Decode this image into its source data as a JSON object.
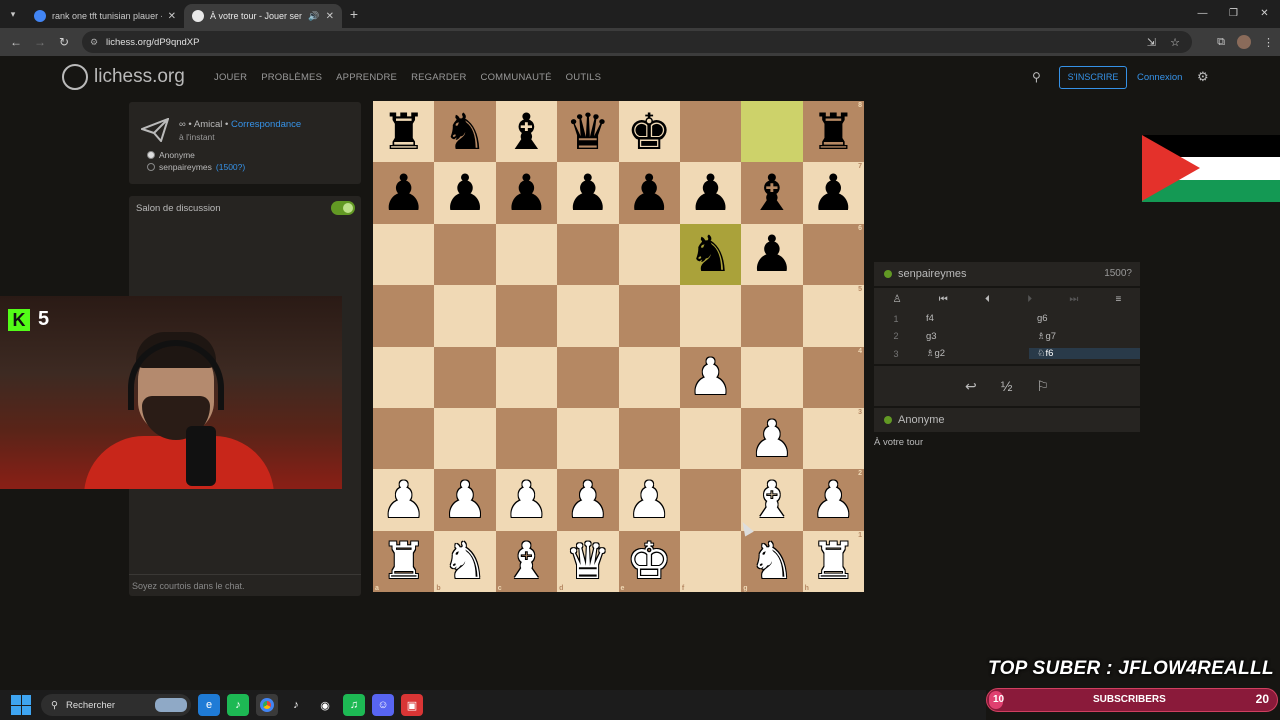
{
  "browser": {
    "tabs": [
      {
        "title": "rank one tft tunisian plauer - Go",
        "active": false
      },
      {
        "title": "À votre tour - Jouer senpa",
        "active": true
      }
    ],
    "url": "lichess.org/dP9qndXP"
  },
  "header": {
    "logo": "lichess.org",
    "nav": [
      "JOUER",
      "PROBLÈMES",
      "APPRENDRE",
      "REGARDER",
      "COMMUNAUTÉ",
      "OUTILS"
    ],
    "signup": "S'INSCRIRE",
    "signin": "Connexion"
  },
  "game_info": {
    "mode_prefix": "∞ • Amical • ",
    "mode_link": "Correspondance",
    "time": "à l'instant",
    "players": [
      {
        "color": "white",
        "name": "Anonyme",
        "rating": ""
      },
      {
        "color": "black",
        "name": "senpaireymes",
        "rating": "(1500?)"
      }
    ]
  },
  "chat": {
    "title": "Salon de discussion",
    "placeholder": "Soyez courtois dans le chat."
  },
  "stream": {
    "kick_count": "5",
    "top_suber": "TOP SUBER : JFLOW4REALLL",
    "sub_count": "10",
    "sub_label": "SUBSCRIBERS",
    "sub_goal": "20"
  },
  "board": {
    "rows": [
      [
        "r",
        "n",
        "b",
        "q",
        "k",
        "",
        "",
        "r"
      ],
      [
        "p",
        "p",
        "p",
        "p",
        "p",
        "p",
        "b",
        "p"
      ],
      [
        "",
        "",
        "",
        "",
        "",
        "n",
        "p",
        ""
      ],
      [
        "",
        "",
        "",
        "",
        "",
        "",
        "",
        ""
      ],
      [
        "",
        "",
        "",
        "",
        "",
        "P",
        "",
        ""
      ],
      [
        "",
        "",
        "",
        "",
        "",
        "",
        "P",
        ""
      ],
      [
        "P",
        "P",
        "P",
        "P",
        "P",
        "",
        "B",
        "P"
      ],
      [
        "R",
        "N",
        "B",
        "Q",
        "K",
        "",
        "N",
        "R"
      ]
    ],
    "highlights": [
      "g8",
      "f6"
    ],
    "ranks": [
      "8",
      "7",
      "6",
      "5",
      "4",
      "3",
      "2",
      "1"
    ],
    "files": [
      "a",
      "b",
      "c",
      "d",
      "e",
      "f",
      "g",
      "h"
    ]
  },
  "opponent": {
    "name": "senpaireymes",
    "rating": "1500?"
  },
  "moves": [
    {
      "num": "1",
      "white": "f4",
      "black": "g6"
    },
    {
      "num": "2",
      "white": "g3",
      "black": "♗g7"
    },
    {
      "num": "3",
      "white": "♗g2",
      "black": "♘f6"
    }
  ],
  "player": {
    "name": "Anonyme"
  },
  "status": "À votre tour",
  "taskbar": {
    "search_placeholder": "Rechercher"
  }
}
